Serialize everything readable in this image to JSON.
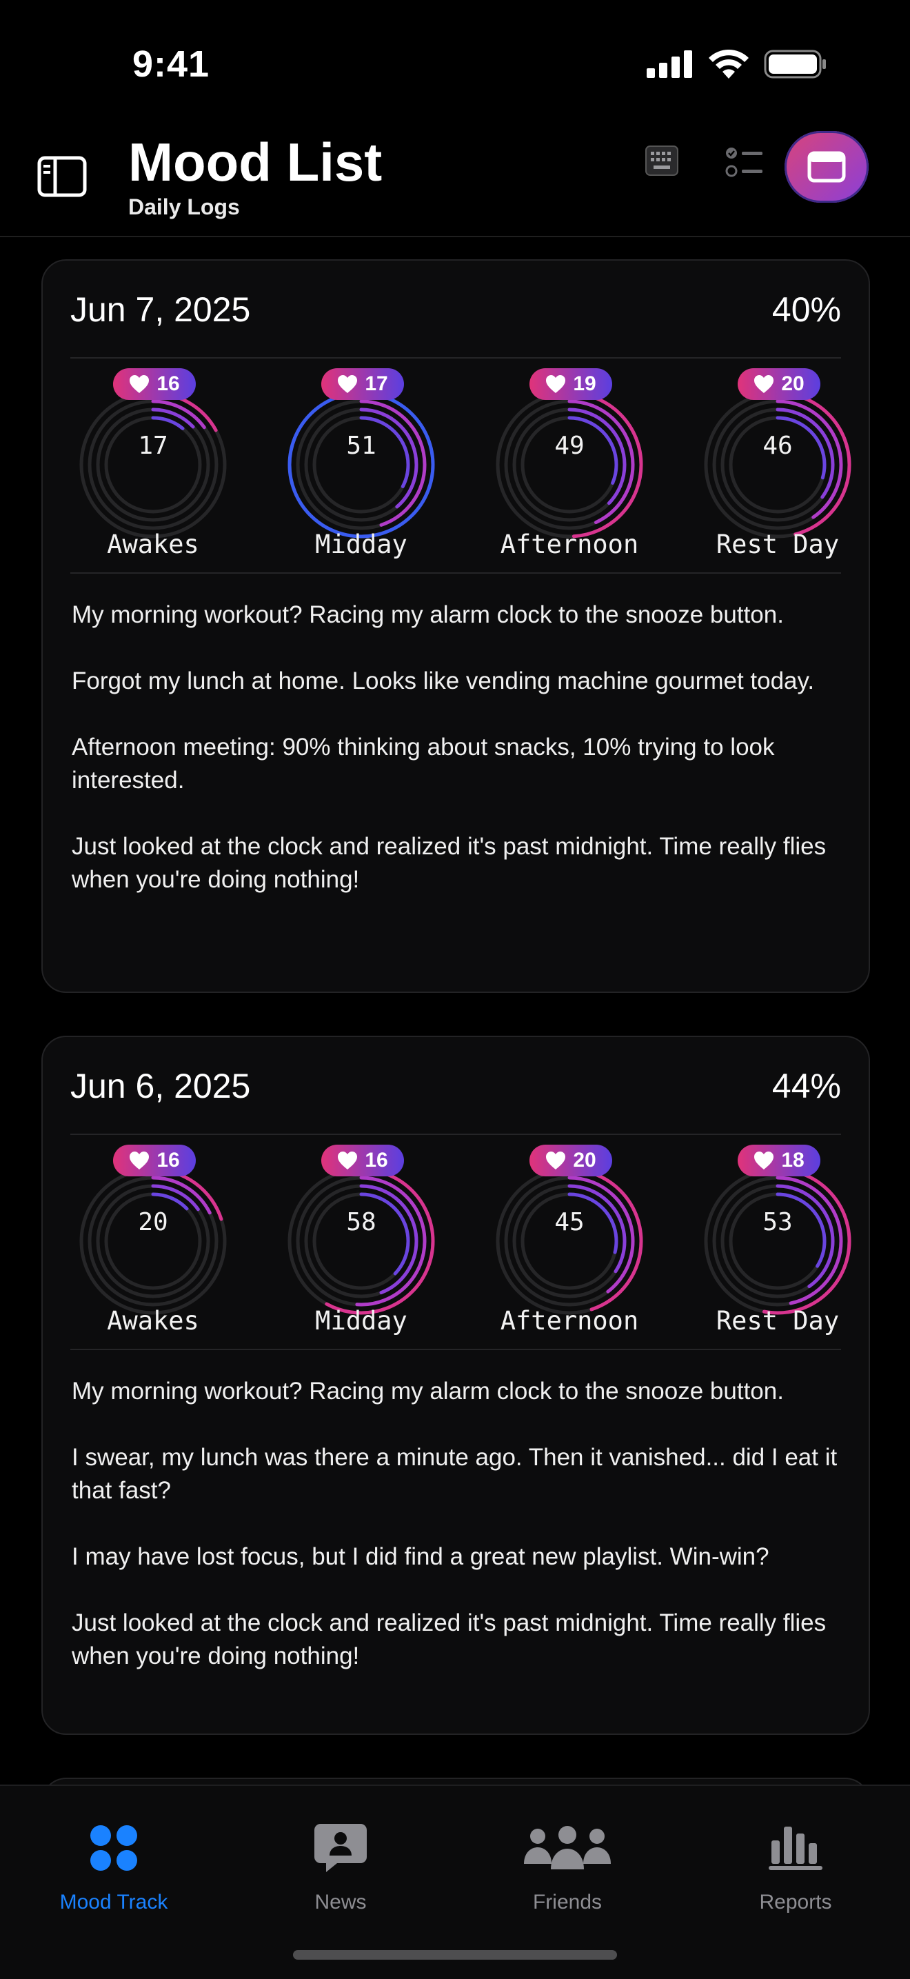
{
  "status": {
    "time": "9:41"
  },
  "header": {
    "title": "Mood List",
    "subtitle": "Daily Logs"
  },
  "entries": [
    {
      "date": "Jun 7, 2025",
      "percent": "40%",
      "rings": [
        {
          "label": "Awakes",
          "value": "17",
          "hearts": "16",
          "level": 0.17,
          "outer": 0.17
        },
        {
          "label": "Midday",
          "value": "51",
          "hearts": "17",
          "level": 0.51,
          "outer": 1.0
        },
        {
          "label": "Afternoon",
          "value": "49",
          "hearts": "19",
          "level": 0.49,
          "outer": 0.49
        },
        {
          "label": "Rest Day",
          "value": "46",
          "hearts": "20",
          "level": 0.46,
          "outer": 0.46
        }
      ],
      "notes": [
        "My morning workout? Racing my alarm clock to the snooze button.",
        "Forgot my lunch at home. Looks like vending machine gourmet today.",
        "Afternoon meeting: 90% thinking about snacks, 10% trying to look interested.",
        "Just looked at the clock and realized it's past midnight. Time really flies when you're doing nothing!"
      ]
    },
    {
      "date": "Jun 6, 2025",
      "percent": "44%",
      "rings": [
        {
          "label": "Awakes",
          "value": "20",
          "hearts": "16",
          "level": 0.2,
          "outer": 0.2
        },
        {
          "label": "Midday",
          "value": "58",
          "hearts": "16",
          "level": 0.58,
          "outer": 0.58
        },
        {
          "label": "Afternoon",
          "value": "45",
          "hearts": "20",
          "level": 0.45,
          "outer": 0.45
        },
        {
          "label": "Rest Day",
          "value": "53",
          "hearts": "18",
          "level": 0.53,
          "outer": 0.53
        }
      ],
      "notes": [
        "My morning workout? Racing my alarm clock to the snooze button.",
        "I swear, my lunch was there a minute ago. Then it vanished... did I eat it that fast?",
        "I may have lost focus, but I did find a great new playlist. Win-win?",
        "Just looked at the clock and realized it's past midnight. Time really flies when you're doing nothing!"
      ]
    }
  ],
  "tabs": [
    {
      "label": "Mood Track",
      "icon": "grid-dots-icon",
      "active": true
    },
    {
      "label": "News",
      "icon": "chat-bubble-person-icon",
      "active": false
    },
    {
      "label": "Friends",
      "icon": "people-group-icon",
      "active": false
    },
    {
      "label": "Reports",
      "icon": "bar-chart-icon",
      "active": false
    }
  ],
  "colors": {
    "accent": "#1a82ff",
    "ring_pink": "#e0337a",
    "ring_purple": "#8a3fd9",
    "ring_blue": "#3a5cf0"
  }
}
